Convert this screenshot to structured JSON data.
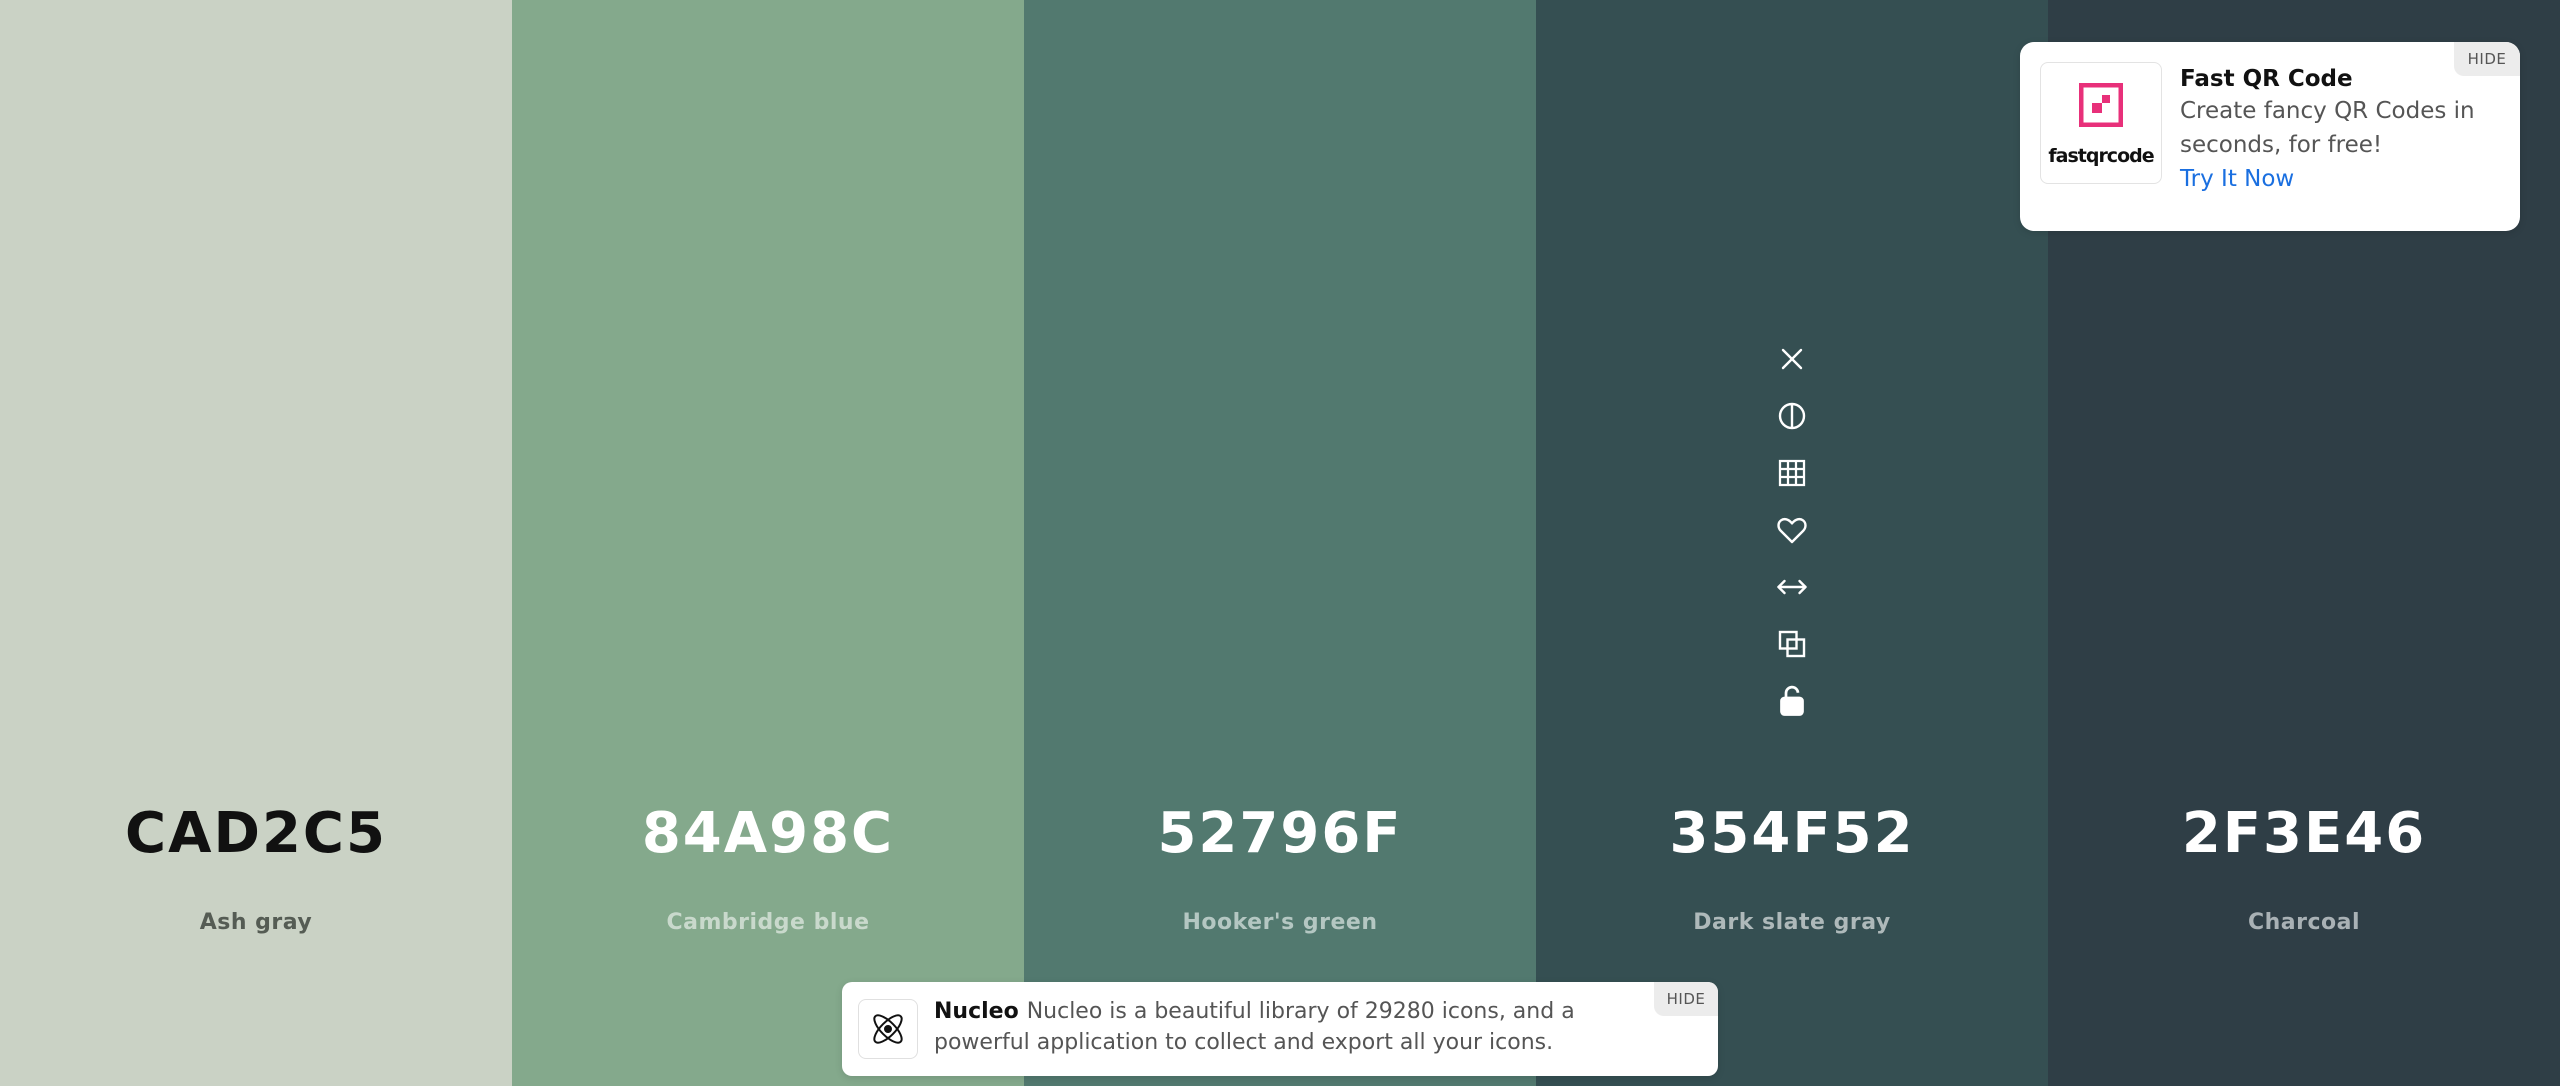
{
  "palette": [
    {
      "hex": "CAD2C5",
      "name": "Ash gray",
      "bg": "#CAD2C5",
      "hex_color": "#111111",
      "name_color": "#555c54"
    },
    {
      "hex": "84A98C",
      "name": "Cambridge blue",
      "bg": "#84A98C",
      "hex_color": "#ffffff",
      "name_color": "#c9d9cc"
    },
    {
      "hex": "52796F",
      "name": "Hooker's green",
      "bg": "#52796F",
      "hex_color": "#ffffff",
      "name_color": "#b4c7c2"
    },
    {
      "hex": "354F52",
      "name": "Dark slate gray",
      "bg": "#354F52",
      "hex_color": "#ffffff",
      "name_color": "#aeb9ba"
    },
    {
      "hex": "2F3E46",
      "name": "Charcoal",
      "bg": "#2F3E46",
      "hex_color": "#ffffff",
      "name_color": "#a9b1b5"
    }
  ],
  "toolbar_icons": [
    "close-icon",
    "contrast-icon",
    "shades-grid-icon",
    "heart-icon",
    "drag-arrows-icon",
    "copy-icon",
    "unlock-icon"
  ],
  "ad_top": {
    "title": "Fast QR Code",
    "description": "Create fancy QR Codes in seconds, for free!",
    "cta": "Try It Now",
    "hide_label": "HIDE",
    "logo_text": "fastqrcode",
    "logo_color": "#e8307a"
  },
  "ad_bottom": {
    "brand": "Nucleo",
    "description": "Nucleo is a beautiful library of 29280 icons, and a powerful application to collect and export all your icons.",
    "hide_label": "HIDE"
  }
}
